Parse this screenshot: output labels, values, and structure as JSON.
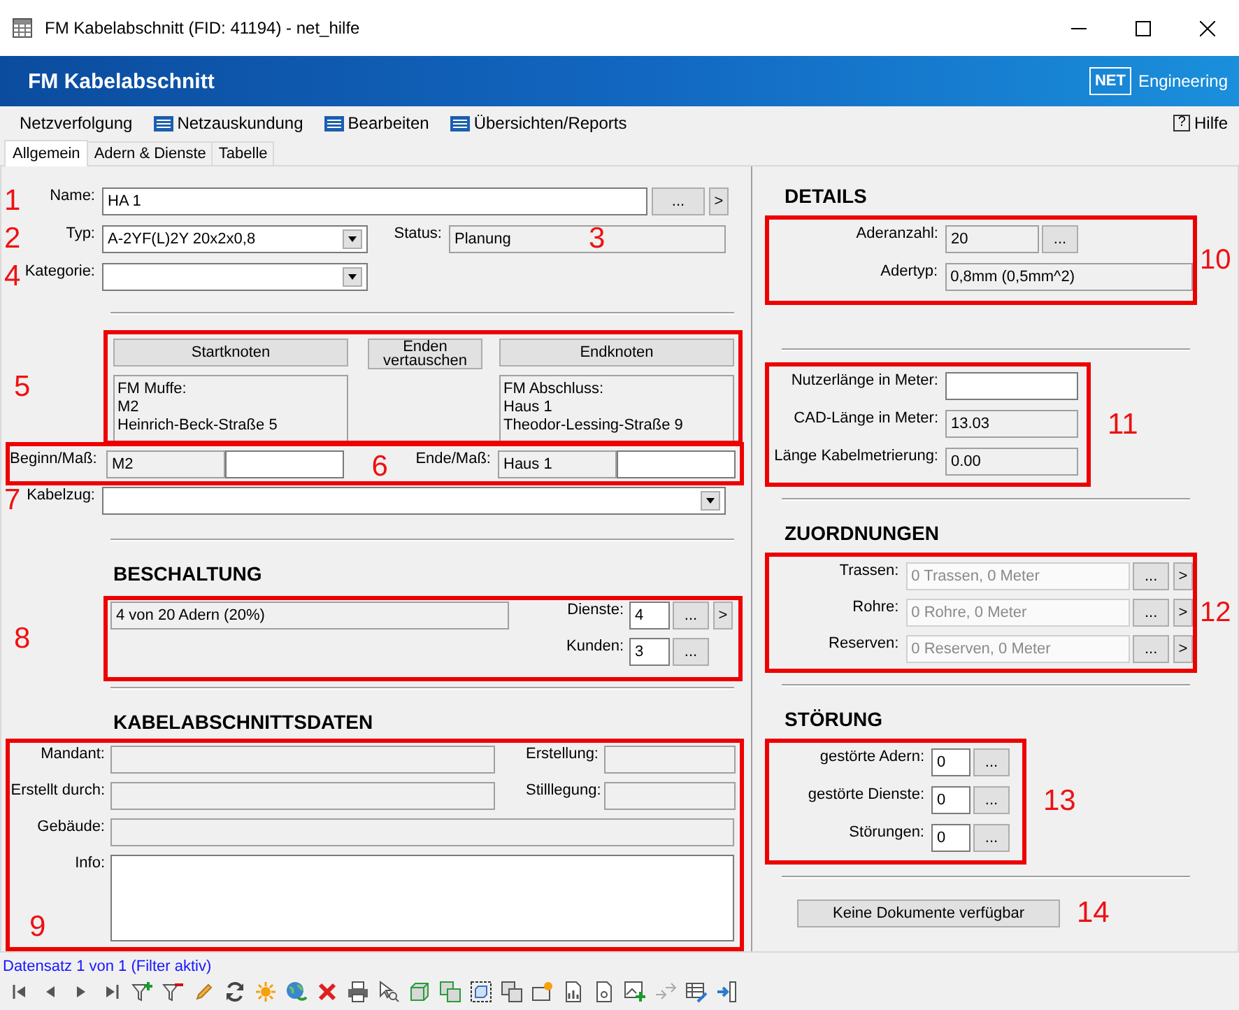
{
  "window": {
    "title": "FM Kabelabschnitt (FID: 41194) - net_hilfe"
  },
  "header": {
    "title": "FM Kabelabschnitt",
    "logo": "NET",
    "brand": "Engineering"
  },
  "menu": [
    {
      "label": "Netzverfolgung",
      "icon": false
    },
    {
      "label": "Netzauskundung",
      "icon": true
    },
    {
      "label": "Bearbeiten",
      "icon": true
    },
    {
      "label": "Übersichten/Reports",
      "icon": true
    }
  ],
  "help": {
    "icon": "?",
    "label": "Hilfe"
  },
  "tabs": [
    {
      "label": "Allgemein",
      "selected": true
    },
    {
      "label": "Adern & Dienste",
      "selected": false
    },
    {
      "label": "Tabelle",
      "selected": false
    }
  ],
  "general": {
    "name": {
      "marker": "1",
      "label": "Name:",
      "value": "HA 1",
      "readonly": false,
      "more": "...",
      "go": ">"
    },
    "typ": {
      "marker": "2",
      "label": "Typ:",
      "value": "A-2YF(L)2Y 20x2x0,8",
      "readonly": false
    },
    "status": {
      "marker": "3",
      "label": "Status:",
      "value": "Planung",
      "readonly": true
    },
    "kategorie": {
      "marker": "4",
      "label": "Kategorie:",
      "readonly": false
    },
    "nodes": {
      "marker": "5",
      "start": {
        "button": "Startknoten",
        "lines": [
          "FM Muffe:",
          "M2",
          "Heinrich-Beck-Straße 5"
        ]
      },
      "swap": "Enden vertauschen",
      "end": {
        "button": "Endknoten",
        "lines": [
          "FM Abschluss:",
          "Haus 1",
          "Theodor-Lessing-Straße 9"
        ]
      }
    },
    "ends": {
      "marker": "6",
      "begin": {
        "label": "Beginn/Maß:",
        "value": "M2",
        "readonly": true
      },
      "begin_measure": {
        "readonly": false
      },
      "end": {
        "label": "Ende/Maß:",
        "value": "Haus 1",
        "readonly": true
      },
      "end_measure": {
        "readonly": false
      }
    },
    "kabelzug": {
      "marker": "7",
      "label": "Kabelzug:",
      "readonly": false
    }
  },
  "beschaltung": {
    "title": "BESCHALTUNG",
    "marker": "8",
    "summary": {
      "value": "4 von 20 Adern (20%)",
      "readonly": true
    },
    "rows": [
      {
        "label": "Dienste:",
        "value": "4",
        "readonly": false,
        "more": "...",
        "go": ">"
      },
      {
        "label": "Kunden:",
        "value": "3",
        "readonly": false,
        "more": "..."
      }
    ]
  },
  "daten": {
    "title": "KABELABSCHNITTSDATEN",
    "marker": "9",
    "rows": [
      [
        {
          "label": "Mandant:",
          "kind": "text",
          "readonly": true
        },
        {
          "label": "Erstellung:",
          "kind": "text",
          "readonly": true
        }
      ],
      [
        {
          "label": "Erstellt durch:",
          "kind": "text",
          "readonly": true
        },
        {
          "label": "Stilllegung:",
          "kind": "text",
          "readonly": true
        }
      ],
      [
        {
          "label": "Gebäude:",
          "kind": "text",
          "readonly": true
        }
      ],
      [
        {
          "label": "Info:",
          "kind": "multiline",
          "readonly": false
        }
      ]
    ]
  },
  "details": {
    "title": "DETAILS",
    "marker": "10",
    "rows": [
      {
        "label": "Aderanzahl:",
        "value": "20",
        "readonly": true,
        "more": "..."
      },
      {
        "label": "Adertyp:",
        "value": "0,8mm (0,5mm^2)",
        "readonly": true
      }
    ]
  },
  "lengths": {
    "marker": "11",
    "rows": [
      {
        "label": "Nutzerlänge in Meter:",
        "readonly": false
      },
      {
        "label": "CAD-Länge in Meter:",
        "value": "13.03",
        "readonly": true
      },
      {
        "label": "Länge Kabelmetrierung:",
        "value": "0.00",
        "readonly": true
      }
    ]
  },
  "zuordnungen": {
    "title": "ZUORDNUNGEN",
    "marker": "12",
    "rows": [
      {
        "label": "Trassen:",
        "value": "0 Trassen, 0 Meter",
        "disabled": true,
        "more": "...",
        "go": ">"
      },
      {
        "label": "Rohre:",
        "value": "0 Rohre, 0 Meter",
        "disabled": true,
        "more": "...",
        "go": ">"
      },
      {
        "label": "Reserven:",
        "value": "0 Reserven, 0 Meter",
        "disabled": true,
        "more": "...",
        "go": ">"
      }
    ]
  },
  "stoerung": {
    "title": "STÖRUNG",
    "marker": "13",
    "rows": [
      {
        "label": "gestörte Adern:",
        "value": "0",
        "readonly": false,
        "more": "..."
      },
      {
        "label": "gestörte Dienste:",
        "value": "0",
        "readonly": false,
        "more": "..."
      },
      {
        "label": "Störungen:",
        "value": "0",
        "readonly": false,
        "more": "..."
      }
    ]
  },
  "documents": {
    "button": "Keine Dokumente verfügbar",
    "marker": "14"
  },
  "status_bar": {
    "text": "Datensatz 1 von 1 (Filter aktiv)"
  }
}
